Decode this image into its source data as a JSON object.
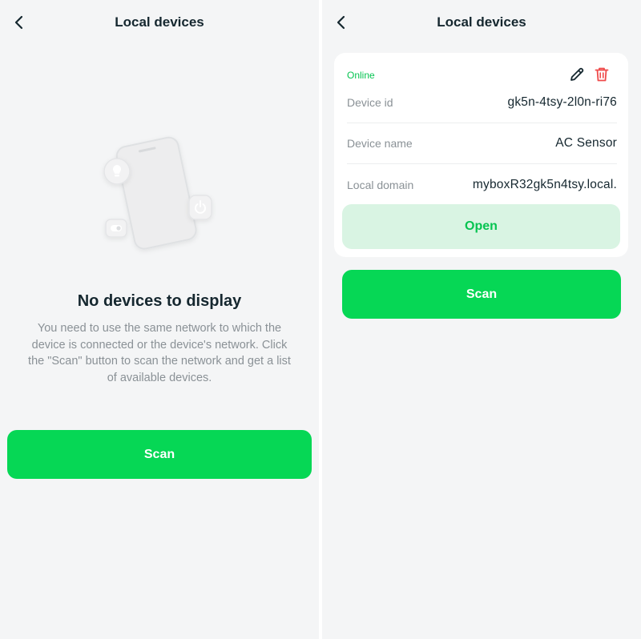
{
  "left_screen": {
    "header": {
      "title": "Local devices"
    },
    "empty_state": {
      "title": "No devices to display",
      "description": "You need to use the same network to which the device is connected or the device's network. Click the \"Scan\" button to scan the network and get a list of available devices."
    },
    "scan_label": "Scan"
  },
  "right_screen": {
    "header": {
      "title": "Local devices"
    },
    "device": {
      "status": "Online",
      "fields": [
        {
          "label": "Device id",
          "value": "gk5n-4tsy-2l0n-ri76"
        },
        {
          "label": "Device name",
          "value": "AC Sensor"
        },
        {
          "label": "Local domain",
          "value": "myboxR32gk5n4tsy.local."
        }
      ],
      "open_label": "Open"
    },
    "scan_label": "Scan"
  },
  "colors": {
    "accent": "#06d755",
    "accent_soft": "#d9f4e3",
    "online": "#06c451",
    "delete": "#ef4b4b",
    "background": "#f4f5f6"
  },
  "icons": [
    "chevron-left-icon",
    "pencil-icon",
    "trash-icon",
    "phone-illustration"
  ]
}
